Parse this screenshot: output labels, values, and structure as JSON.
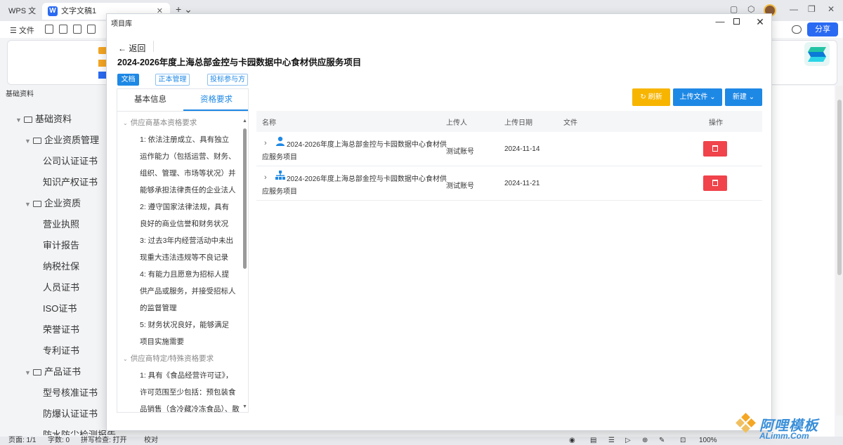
{
  "wps": {
    "tabs": [
      {
        "label": "WPS 文字"
      },
      {
        "label": "文字文稿1",
        "icon": "W"
      }
    ],
    "menu_file": "文件",
    "share_label": "分享",
    "pane_title": "基础资料",
    "tree": [
      {
        "label": "基础资料",
        "level": 0,
        "folder": true
      },
      {
        "label": "企业资质管理",
        "level": 1,
        "folder": true
      },
      {
        "label": "公司认证证书",
        "level": 2
      },
      {
        "label": "知识产权证书",
        "level": 2
      },
      {
        "label": "企业资质",
        "level": 1,
        "folder": true
      },
      {
        "label": "营业执照",
        "level": 2
      },
      {
        "label": "审计报告",
        "level": 2
      },
      {
        "label": "纳税社保",
        "level": 2
      },
      {
        "label": "人员证书",
        "level": 2
      },
      {
        "label": "ISO证书",
        "level": 2
      },
      {
        "label": "荣誉证书",
        "level": 2
      },
      {
        "label": "专利证书",
        "level": 2
      },
      {
        "label": "产品证书",
        "level": 1,
        "folder": true
      },
      {
        "label": "型号核准证书",
        "level": 2
      },
      {
        "label": "防爆认证证书",
        "level": 2
      },
      {
        "label": "防水防尘检测报告",
        "level": 2
      }
    ],
    "status": {
      "page": "页面: 1/1",
      "words": "字数: 0",
      "spell": "拼写检查: 打开",
      "proof": "校对",
      "zoom": "100%"
    }
  },
  "dialog": {
    "title": "项目库",
    "back_label": "返回",
    "project_title": "2024-2026年度上海总部金控与卡园数据中心食材供应服务项目",
    "tags": {
      "doc": "文档",
      "zb": "正本管理",
      "tb": "投标参与方"
    },
    "tabs": {
      "basic": "基本信息",
      "qual": "资格要求"
    },
    "groups": [
      {
        "title": "供应商基本资格要求",
        "lines": [
          "1:   依法注册成立、具有独立",
          "运作能力（包括运营、财务、",
          "组织、管理、市场等状况）并",
          "能够承担法律责任的企业法人",
          "2:   遵守国家法律法规，具有",
          "良好的商业信誉和财务状况",
          "3:   过去3年内经营活动中未出",
          "现重大违法违规等不良记录",
          "4:   有能力且愿意为招标人提",
          "供产品或服务，并接受招标人",
          "的监督管理",
          "5:   财务状况良好，能够满足",
          "项目实施需要"
        ]
      },
      {
        "title": "供应商特定/特殊资格要求",
        "lines": [
          "1:   具有《食品经营许可证》，",
          "许可范围至少包括：预包装食",
          "品销售（含冷藏冷冻食品）、散"
        ]
      }
    ],
    "buttons": {
      "refresh": "刷新",
      "upload": "上传文件",
      "new": "新建"
    },
    "table": {
      "headers": {
        "name": "名称",
        "uploader": "上传人",
        "date": "上传日期",
        "file": "文件",
        "ops": "操作"
      },
      "rows": [
        {
          "name_line1": "2024-2026年度上海总部金控与卡园数据中心食材供",
          "name_line2": "应服务项目",
          "uploader": "测试账号",
          "date": "2024-11-14",
          "icon": "user-icon"
        },
        {
          "name_line1": "2024-2026年度上海总部金控与卡园数据中心食材供",
          "name_line2": "应服务项目",
          "uploader": "测试账号",
          "date": "2024-11-21",
          "icon": "org-icon"
        }
      ]
    }
  },
  "watermark": {
    "text": "阿哩模板",
    "sub": "ALimm.Com"
  },
  "colors": {
    "accent": "#1e88e5",
    "warning": "#f7b500",
    "danger": "#f0434b"
  }
}
